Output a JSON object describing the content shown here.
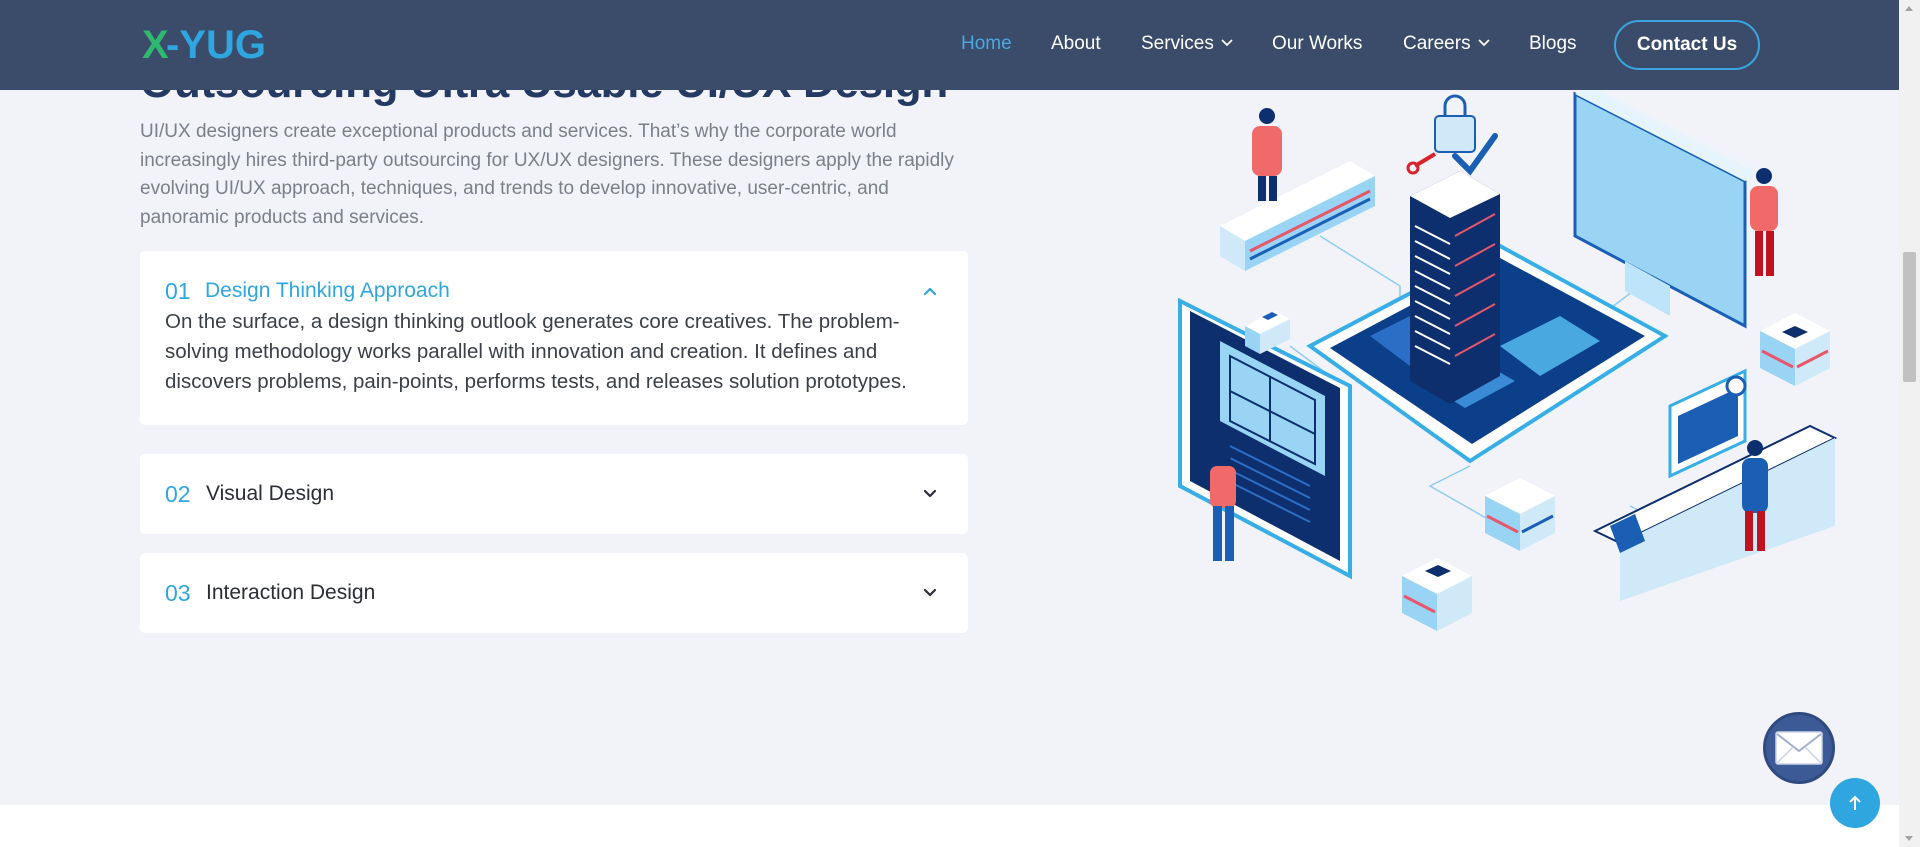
{
  "nav": {
    "logo_text": "X-YUG",
    "items": [
      {
        "label": "Home",
        "active": true
      },
      {
        "label": "About"
      },
      {
        "label": "Services",
        "dropdown": true
      },
      {
        "label": "Our Works"
      },
      {
        "label": "Careers",
        "dropdown": true
      },
      {
        "label": "Blogs"
      }
    ],
    "contact_label": "Contact Us"
  },
  "section": {
    "heading": "Outsourcing Ultra Usable UI/UX Design",
    "intro": "UI/UX designers create exceptional products and services. That’s why the corporate world increasingly hires third-party outsourcing for UX/UX designers. These designers apply the rapidly evolving UI/UX approach, techniques, and trends to develop innovative, user-centric, and panoramic products and services.",
    "accordion": [
      {
        "num": "01",
        "title": "Design Thinking Approach",
        "open": true,
        "body": "On the surface, a design thinking outlook generates core creatives. The problem-solving methodology works parallel with innovation and creation. It defines and discovers problems, pain-points, performs tests, and releases solution prototypes."
      },
      {
        "num": "02",
        "title": "Visual Design",
        "open": false
      },
      {
        "num": "03",
        "title": "Interaction Design",
        "open": false
      }
    ]
  },
  "colors": {
    "header_bg": "#3b4c6b",
    "accent": "#2fa6df",
    "heading": "#253a63",
    "page_bg": "#f2f3f8"
  },
  "icons": {
    "chevron_up": "chevron-up-icon",
    "chevron_down": "chevron-down-icon",
    "mail": "mail-icon",
    "arrow_up": "arrow-up-icon"
  }
}
